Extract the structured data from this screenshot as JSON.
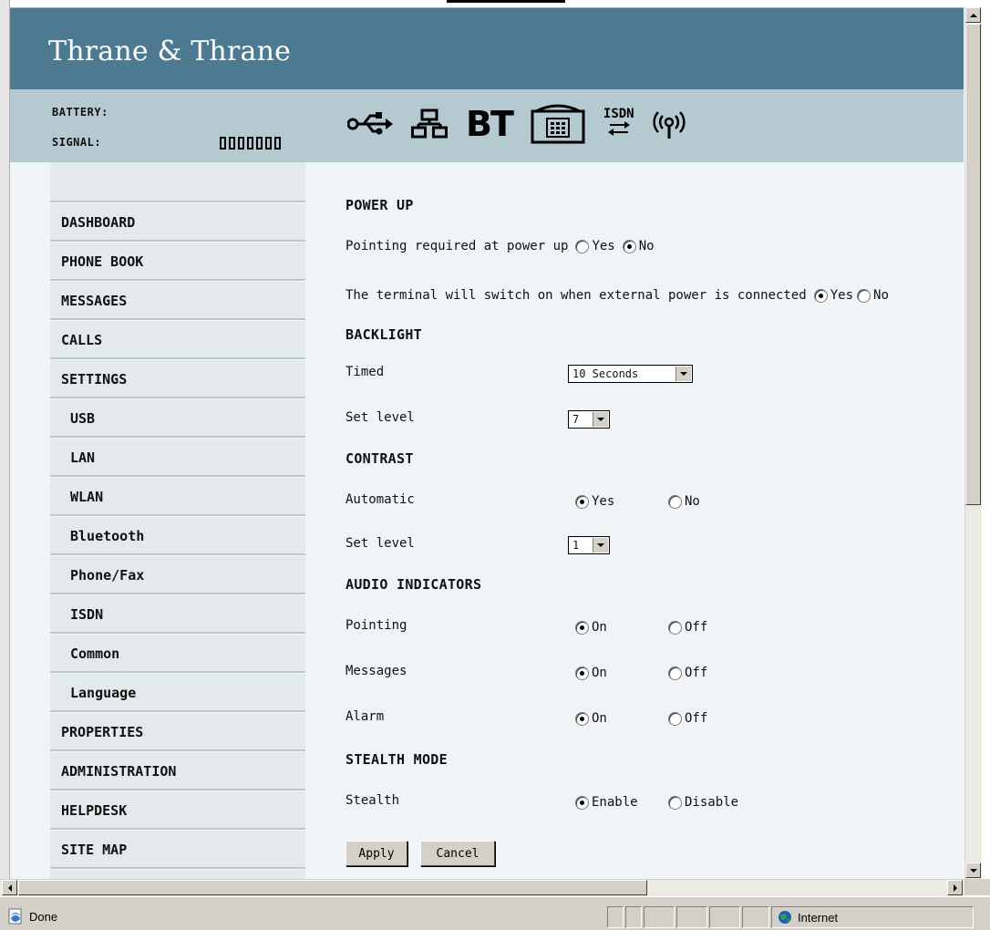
{
  "brand": "Thrane & Thrane",
  "status": {
    "battery_label": "BATTERY:",
    "signal_label": "SIGNAL:",
    "signal_level": 0,
    "signal_segments": 7,
    "icons": [
      "usb-icon",
      "lan-icon",
      "bluetooth-icon",
      "phone-icon",
      "isdn-icon",
      "wlan-icon"
    ],
    "bt_text": "BT",
    "isdn_text": "ISDN"
  },
  "nav": [
    {
      "label": "DASHBOARD",
      "sub": false
    },
    {
      "label": "PHONE BOOK",
      "sub": false
    },
    {
      "label": "MESSAGES",
      "sub": false
    },
    {
      "label": "CALLS",
      "sub": false
    },
    {
      "label": "SETTINGS",
      "sub": false
    },
    {
      "label": "USB",
      "sub": true
    },
    {
      "label": "LAN",
      "sub": true
    },
    {
      "label": "WLAN",
      "sub": true
    },
    {
      "label": "Bluetooth",
      "sub": true
    },
    {
      "label": "Phone/Fax",
      "sub": true
    },
    {
      "label": "ISDN",
      "sub": true
    },
    {
      "label": "Common",
      "sub": true
    },
    {
      "label": "Language",
      "sub": true
    },
    {
      "label": "PROPERTIES",
      "sub": false
    },
    {
      "label": "ADMINISTRATION",
      "sub": false
    },
    {
      "label": "HELPDESK",
      "sub": false
    },
    {
      "label": "SITE MAP",
      "sub": false
    }
  ],
  "power_up": {
    "title": "POWER UP",
    "pointing_label": "Pointing required at power up",
    "pointing_value": "No",
    "switch_label": "The terminal will switch on when external power is connected",
    "switch_value": "Yes",
    "yes": "Yes",
    "no": "No"
  },
  "backlight": {
    "title": "BACKLIGHT",
    "timed_label": "Timed",
    "timed_value": "10 Seconds",
    "level_label": "Set level",
    "level_value": "7"
  },
  "contrast": {
    "title": "CONTRAST",
    "auto_label": "Automatic",
    "auto_value": "Yes",
    "yes": "Yes",
    "no": "No",
    "level_label": "Set level",
    "level_value": "1"
  },
  "audio": {
    "title": "AUDIO INDICATORS",
    "on": "On",
    "off": "Off",
    "rows": [
      {
        "label": "Pointing",
        "value": "On"
      },
      {
        "label": "Messages",
        "value": "On"
      },
      {
        "label": "Alarm",
        "value": "On"
      }
    ]
  },
  "stealth": {
    "title": "STEALTH MODE",
    "label": "Stealth",
    "enable": "Enable",
    "disable": "Disable",
    "value": "Enable"
  },
  "buttons": {
    "apply": "Apply",
    "cancel": "Cancel"
  },
  "browser_status": {
    "text": "Done",
    "zone": "Internet"
  }
}
